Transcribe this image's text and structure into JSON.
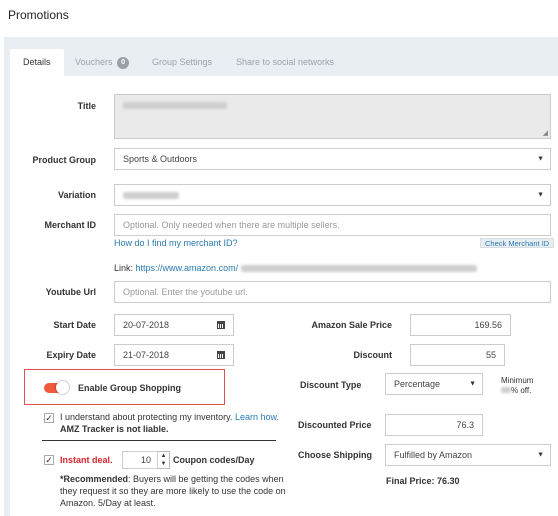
{
  "page": {
    "title": "Promotions"
  },
  "tabs": [
    {
      "label": "Details"
    },
    {
      "label": "Vouchers",
      "badge": "0"
    },
    {
      "label": "Group Settings"
    },
    {
      "label": "Share to social networks"
    }
  ],
  "form": {
    "title_label": "Title",
    "product_group_label": "Product Group",
    "product_group_value": "Sports & Outdoors",
    "variation_label": "Variation",
    "merchant_label": "Merchant ID",
    "merchant_placeholder": "Optional. Only needed when there are multiple sellers.",
    "merchant_help_link": "How do I find my merchant ID?",
    "check_merchant_button": "Check Merchant ID",
    "link_label": "Link:",
    "link_url": "https://www.amazon.com/",
    "youtube_label": "Youtube Url",
    "youtube_placeholder": "Optional. Enter the youtube url.",
    "start_date_label": "Start Date",
    "start_date_value": "20-07-2018",
    "expiry_date_label": "Expiry Date",
    "expiry_date_value": "21-07-2018",
    "sale_price_label": "Amazon Sale Price",
    "sale_price_value": "169.56",
    "discount_label": "Discount",
    "discount_value": "55",
    "discount_type_label": "Discount Type",
    "discount_type_value": "Percentage",
    "minimum_label": "Minimum",
    "minimum_suffix": "% off.",
    "discounted_price_label": "Discounted Price",
    "discounted_price_value": "76.3",
    "shipping_label": "Choose Shipping",
    "shipping_value": "Fulfilled by Amazon",
    "final_price": "Final Price: 76.30"
  },
  "group_shopping": {
    "label": "Enable Group Shopping",
    "enabled": true,
    "accent": "#f05a3a"
  },
  "inventory": {
    "text": "I understand about protecting my inventory.",
    "learn_link": "Learn how.",
    "liability": "AMZ Tracker is not liable."
  },
  "instant_deal": {
    "label": "Instant deal.",
    "value": "10",
    "unit": "Coupon codes/Day",
    "recommended_label": "*Recommended",
    "recommended_text": ": Buyers will be getting the codes when",
    "recommended_line2": "they request it so they are more likely to use the code on",
    "recommended_line3": "Amazon. 5/Day at least."
  }
}
